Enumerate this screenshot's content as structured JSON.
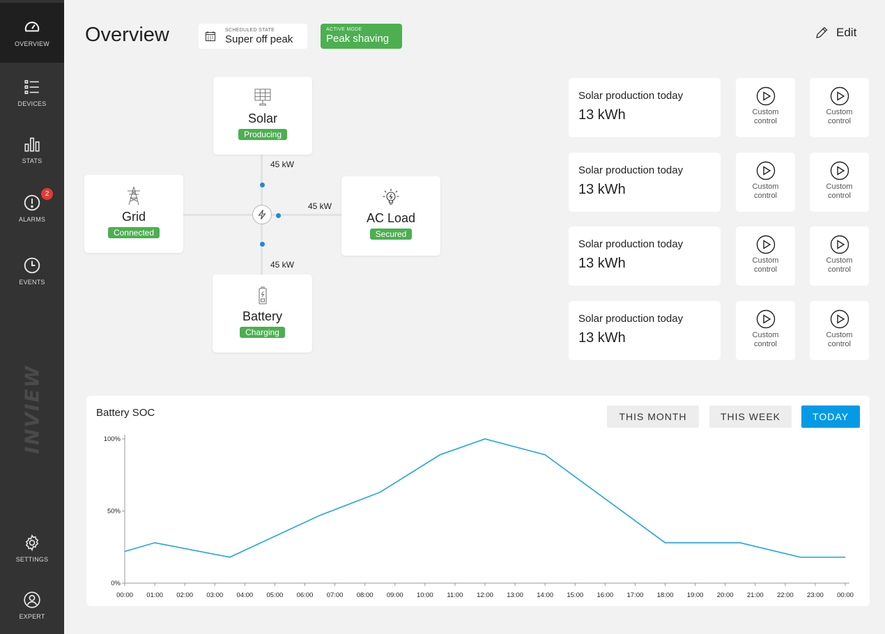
{
  "sidebar": {
    "items": [
      {
        "label": "OVERVIEW",
        "icon": "gauge-icon"
      },
      {
        "label": "DEVICES",
        "icon": "list-icon"
      },
      {
        "label": "STATS",
        "icon": "bar-chart-icon"
      },
      {
        "label": "ALARMS",
        "icon": "alert-icon",
        "badge": "2"
      },
      {
        "label": "EVENTS",
        "icon": "clock-icon"
      },
      {
        "label": "SETTINGS",
        "icon": "gear-icon"
      },
      {
        "label": "EXPERT",
        "icon": "user-icon"
      }
    ],
    "brand": "INVIEW"
  },
  "header": {
    "title": "Overview",
    "scheduled_state": {
      "label": "SCHEDULED STATE",
      "value": "Super off peak"
    },
    "active_mode": {
      "label": "ACTIVE MODE",
      "value": "Peak shaving"
    },
    "edit_label": "Edit"
  },
  "flow": {
    "solar": {
      "name": "Solar",
      "status": "Producing",
      "power": "45 kW"
    },
    "grid": {
      "name": "Grid",
      "status": "Connected"
    },
    "ac_load": {
      "name": "AC Load",
      "status": "Secured",
      "power": "45 kW"
    },
    "battery": {
      "name": "Battery",
      "status": "Charging",
      "power": "45 kW"
    }
  },
  "cards": [
    {
      "title": "Solar production today",
      "value": "13 kWh",
      "controls": [
        "Custom control",
        "Custom control"
      ]
    },
    {
      "title": "Solar production today",
      "value": "13 kWh",
      "controls": [
        "Custom control",
        "Custom control"
      ]
    },
    {
      "title": "Solar production today",
      "value": "13 kWh",
      "controls": [
        "Custom control",
        "Custom control"
      ]
    },
    {
      "title": "Solar production today",
      "value": "13 kWh",
      "controls": [
        "Custom control",
        "Custom control"
      ]
    }
  ],
  "colors": {
    "sidebar_bg": "#333333",
    "accent_blue": "#039be5",
    "status_green": "#4caf50",
    "badge_red": "#e53935"
  },
  "range_buttons": [
    "THIS MONTH",
    "THIS WEEK",
    "TODAY"
  ],
  "active_range": "TODAY",
  "chart_data": {
    "type": "line",
    "title": "Battery SOC",
    "xlabel": "",
    "ylabel": "",
    "y_ticks": [
      "100%",
      "50%",
      "0%"
    ],
    "ylim": [
      0,
      100
    ],
    "x_ticks": [
      "00:00",
      "01:00",
      "02:00",
      "03:00",
      "04:00",
      "05:00",
      "06:00",
      "07:00",
      "08:00",
      "09:00",
      "10:00",
      "11:00",
      "12:00",
      "13:00",
      "14:00",
      "15:00",
      "16:00",
      "17:00",
      "18:00",
      "19:00",
      "20:00",
      "21:00",
      "22:00",
      "23:00",
      "00:00"
    ],
    "series": [
      {
        "color": "#1ea4e9",
        "x": [
          0,
          1,
          3.5,
          6.5,
          8.5,
          10.5,
          12,
          14,
          18,
          20.5,
          22.5,
          24
        ],
        "y": [
          22,
          28,
          18,
          47,
          63,
          89,
          100,
          89,
          28,
          28,
          18,
          18
        ]
      }
    ],
    "grid": false
  }
}
